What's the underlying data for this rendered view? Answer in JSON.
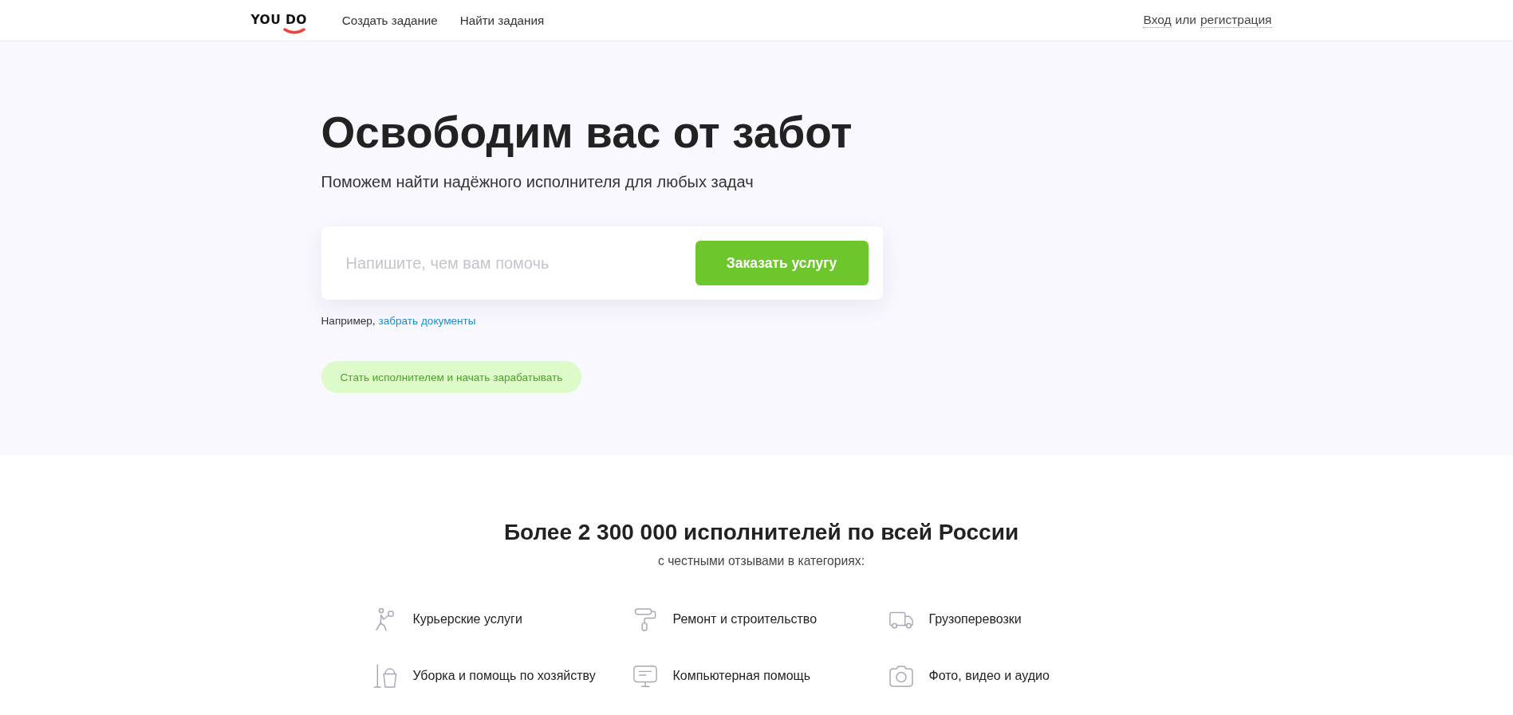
{
  "header": {
    "logo": "YOU DO",
    "nav": [
      {
        "label": "Создать задание"
      },
      {
        "label": "Найти задания"
      }
    ],
    "auth": {
      "login": "Вход",
      "or": "или",
      "register": "регистрация"
    }
  },
  "hero": {
    "title": "Освободим вас от забот",
    "subtitle": "Поможем найти надёжного исполнителя для любых задач",
    "search": {
      "placeholder": "Напишите, чем вам помочь",
      "button": "Заказать услугу"
    },
    "example": {
      "prefix": "Например,",
      "link": "забрать документы"
    },
    "become_worker": "Стать исполнителем и начать зарабатывать"
  },
  "categories_section": {
    "title": "Более 2 300 000 исполнителей по всей России",
    "subtitle": "с честными отзывами в категориях:",
    "categories": [
      {
        "kind": "courier",
        "label": "Курьерские услуги"
      },
      {
        "kind": "repair",
        "label": "Ремонт и строительство"
      },
      {
        "kind": "cargo",
        "label": "Грузоперевозки"
      },
      {
        "kind": "cleaning",
        "label": "Уборка и помощь по хозяйству"
      },
      {
        "kind": "computer",
        "label": "Компьютерная помощь"
      },
      {
        "kind": "photo",
        "label": "Фото, видео и аудио"
      }
    ]
  }
}
